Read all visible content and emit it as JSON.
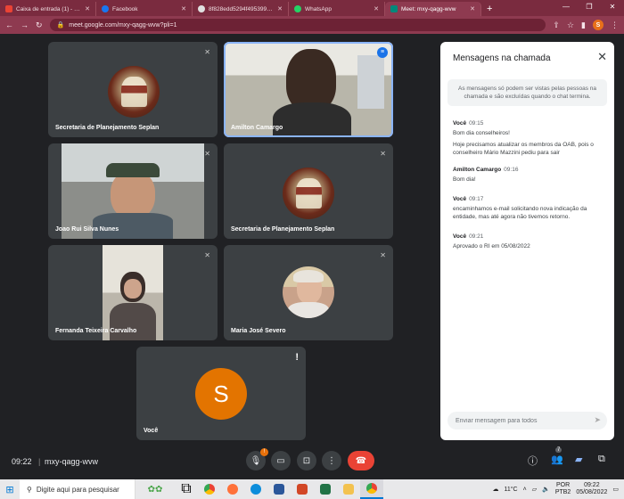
{
  "browser": {
    "tabs": [
      {
        "title": "Caixa de entrada (1) - pla",
        "color": "#ea4335"
      },
      {
        "title": "Facebook",
        "color": "#1877f2"
      },
      {
        "title": "8f828edd5294f495399590...",
        "color": "#e0e0e0"
      },
      {
        "title": "WhatsApp",
        "color": "#25d366"
      },
      {
        "title": "Meet: mxy-qagg-wvw",
        "color": "#00897b"
      }
    ],
    "url": "meet.google.com/mxy-qagg-wvw?pli=1",
    "profile_initial": "S"
  },
  "participants": [
    {
      "name": "Secretaria de Planejamento Seplan"
    },
    {
      "name": "Amilton Camargo"
    },
    {
      "name": "Joao Rui Silva Nunes"
    },
    {
      "name": "Secretaria de Planejamento Seplan"
    },
    {
      "name": "Fernanda Teixeira Carvalho"
    },
    {
      "name": "Maria José Severo"
    },
    {
      "name": "Você",
      "initial": "S"
    }
  ],
  "chat": {
    "title": "Mensagens na chamada",
    "notice": "As mensagens só podem ser vistas pelas pessoas na chamada e são excluídas quando o chat termina.",
    "messages": [
      {
        "sender": "Você",
        "time": "09:15",
        "lines": [
          "Bom dia conselheiros!",
          "Hoje precisamos atualizar os membros da OAB, pois o conselheiro Mário Mazzini pediu para sair"
        ]
      },
      {
        "sender": "Amilton Camargo",
        "time": "09:16",
        "lines": [
          "Bom dia!"
        ]
      },
      {
        "sender": "Você",
        "time": "09:17",
        "lines": [
          "encaminhamos e-mail solicitando nova indicação da entidade, mas até agora não tivemos retorno."
        ]
      },
      {
        "sender": "Você",
        "time": "09:21",
        "lines": [
          "Aprovado o RI em 05/08/2022"
        ]
      }
    ],
    "input_placeholder": "Enviar mensagem para todos"
  },
  "meetbar": {
    "clock": "09:22",
    "separator": "|",
    "meeting_code": "mxy-qagg-wvw",
    "mic_badge": "!",
    "people_count": "7"
  },
  "taskbar": {
    "search_placeholder": "Digite aqui para pesquisar",
    "weather": "11°C",
    "lang_top": "POR",
    "lang_bottom": "PTB2",
    "time": "09:22",
    "date": "05/08/2022"
  }
}
